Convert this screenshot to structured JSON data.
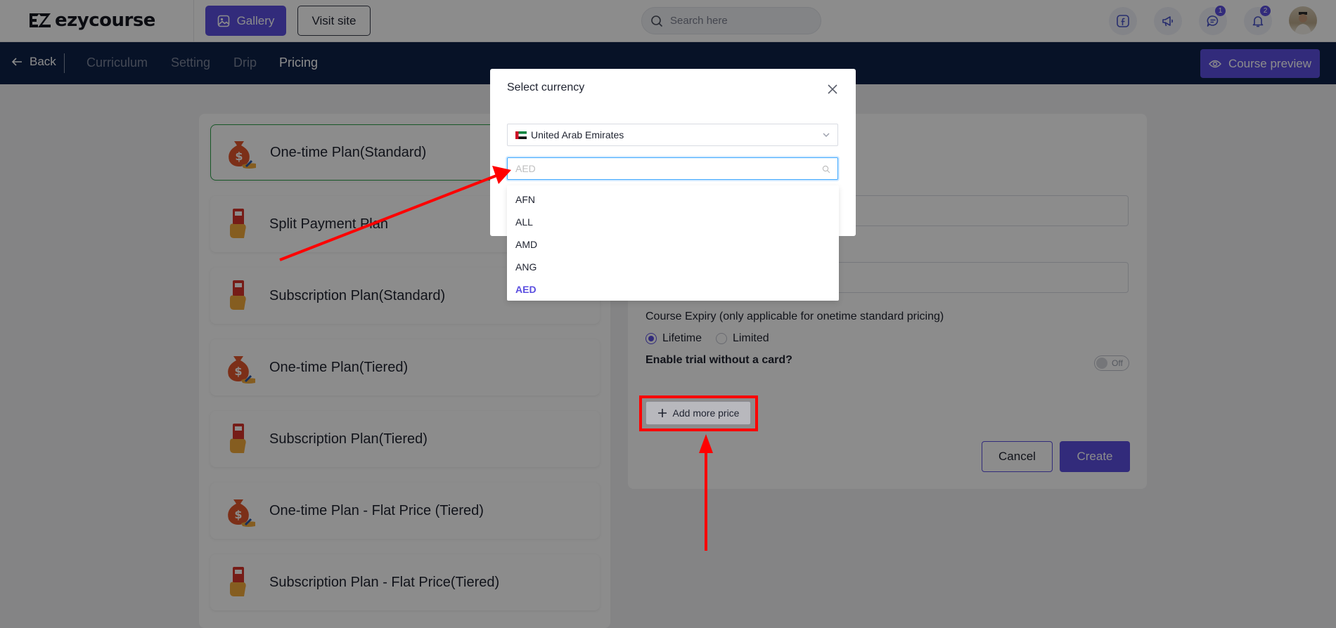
{
  "brand": {
    "name": "ezycourse"
  },
  "topbar": {
    "gallery_label": "Gallery",
    "visit_site_label": "Visit site",
    "search_placeholder": "Search here",
    "messages_badge": "1",
    "notifications_badge": "2"
  },
  "navbar": {
    "back_label": "Back",
    "tabs": [
      {
        "label": "Curriculum"
      },
      {
        "label": "Setting"
      },
      {
        "label": "Drip"
      },
      {
        "label": "Pricing"
      }
    ],
    "active_tab": "Pricing",
    "preview_label": "Course preview"
  },
  "plans": [
    {
      "label": "One-time Plan(Standard)",
      "icon": "money-bag-icon"
    },
    {
      "label": "Split Payment Plan",
      "icon": "card-hand-icon"
    },
    {
      "label": "Subscription Plan(Standard)",
      "icon": "card-hand-icon"
    },
    {
      "label": "One-time Plan(Tiered)",
      "icon": "money-bag-icon"
    },
    {
      "label": "Subscription Plan(Tiered)",
      "icon": "card-hand-icon"
    },
    {
      "label": "One-time Plan - Flat Price (Tiered)",
      "icon": "money-bag-icon"
    },
    {
      "label": "Subscription Plan - Flat Price(Tiered)",
      "icon": "card-hand-icon"
    }
  ],
  "form": {
    "expiry_label": "Course Expiry (only applicable for onetime standard pricing)",
    "expiry_options": [
      "Lifetime",
      "Limited"
    ],
    "expiry_selected": "Lifetime",
    "trial_label": "Enable trial without a card?",
    "trial_toggle": "Off",
    "add_price_label": "Add more price",
    "cancel_label": "Cancel",
    "create_label": "Create"
  },
  "modal": {
    "title": "Select currency",
    "country_value": "United Arab Emirates",
    "currency_placeholder": "AED",
    "currency_options": [
      "AFN",
      "ALL",
      "AMD",
      "ANG",
      "AED"
    ],
    "currency_selected": "AED"
  },
  "colors": {
    "primary": "#5b4fe0",
    "navbar": "#0d2147",
    "annotation": "#ff0000",
    "selected_border": "#2fa14a"
  }
}
